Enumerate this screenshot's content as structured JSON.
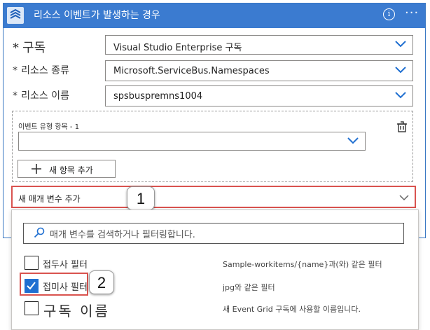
{
  "header": {
    "title": "리소스 이벤트가 발생하는 경우",
    "info_glyph": "i",
    "more_glyph": "···"
  },
  "form": {
    "required_mark": "*",
    "subscription": {
      "label": "구독",
      "value": "Visual  Studio  Enterprise 구독"
    },
    "resource_type": {
      "label": "리소스 종류",
      "value": "Microsoft.ServiceBus.Namespaces"
    },
    "resource_name": {
      "label": "리소스 이름",
      "value": "spsbuspremns1004"
    },
    "event_type_item": {
      "label": "이벤트 유형 항목 - 1",
      "value": ""
    },
    "add_item_label": "새 항목 추가",
    "add_param_label": "새 매개 변수 추가"
  },
  "dropdown": {
    "search_placeholder": "매개 변수를 검색하거나 필터링합니다.",
    "options": [
      {
        "label": "접두사 필터",
        "description": "Sample-workitems/{name}과(와) 같은 필터",
        "checked": false
      },
      {
        "label": "접미사 필터",
        "description": "jpg와 같은 필터",
        "checked": true
      },
      {
        "label": "구독 이름",
        "description": "새 Event Grid 구독에 사용할 이름입니다.",
        "checked": false
      }
    ]
  },
  "callouts": {
    "first": "1",
    "second": "2"
  },
  "colors": {
    "header_bg": "#3b7bd0",
    "accent": "#1f6fd1",
    "highlight": "#d9534f"
  },
  "icons": [
    "event-grid-icon",
    "info-icon",
    "more-icon",
    "chevron-down-icon",
    "delete-icon",
    "plus-icon",
    "search-icon",
    "checkbox-icon",
    "checkmark-icon"
  ]
}
